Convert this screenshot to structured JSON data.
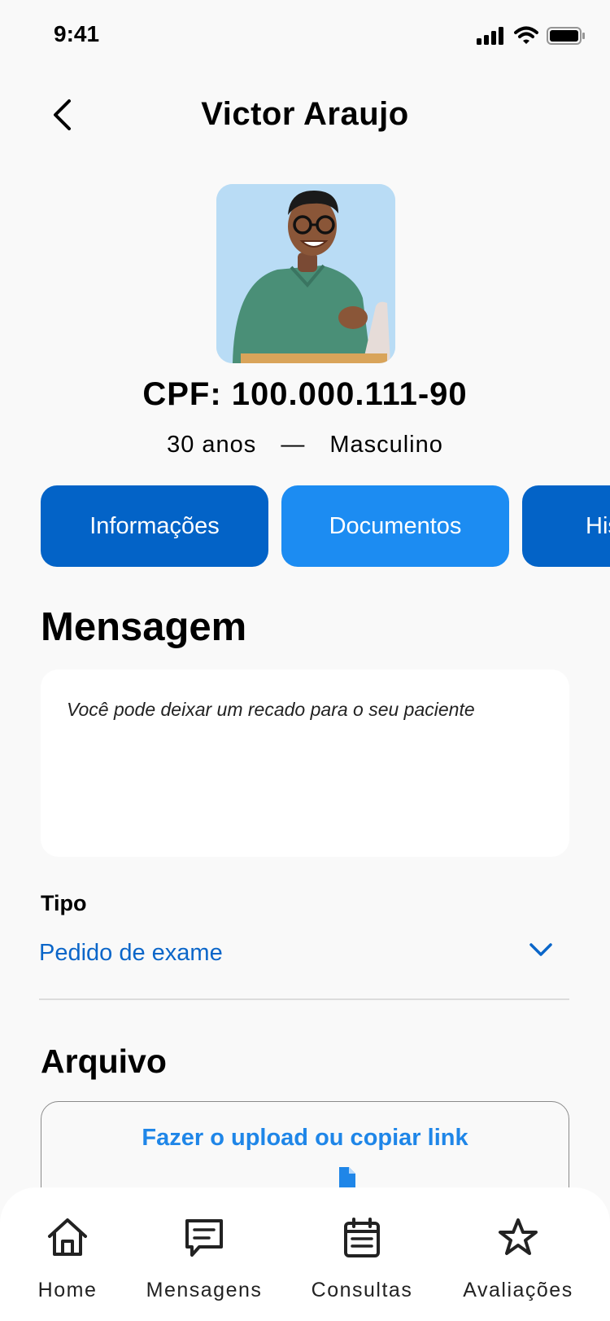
{
  "status_bar": {
    "time": "9:41",
    "icons": [
      "signal-icon",
      "wifi-icon",
      "battery-icon"
    ]
  },
  "header": {
    "back_icon": "chevron-left-icon",
    "title": "Victor Araujo"
  },
  "patient": {
    "cpf": "CPF: 100.000.111-90",
    "age": "30 anos",
    "separator": "—",
    "gender": "Masculino"
  },
  "tabs": [
    {
      "label": "Informações",
      "color": "#0363c7"
    },
    {
      "label": "Documentos",
      "color": "#1c8cf2",
      "selected": true
    },
    {
      "label": "Histórico",
      "color": "#0363c7"
    }
  ],
  "message": {
    "title": "Mensagem",
    "placeholder": "Você pode deixar um recado para o seu paciente"
  },
  "tipo": {
    "label": "Tipo",
    "value": "Pedido de exame",
    "icon": "chevron-down-icon"
  },
  "arquivo": {
    "title": "Arquivo",
    "upload_label": "Fazer o upload ou copiar link",
    "icon": "file-icon"
  },
  "bottom_nav": [
    {
      "label": "Home",
      "icon": "home-icon"
    },
    {
      "label": "Mensagens",
      "icon": "message-icon"
    },
    {
      "label": "Consultas",
      "icon": "calendar-icon"
    },
    {
      "label": "Avaliações",
      "icon": "star-icon"
    }
  ],
  "colors": {
    "primary_dark": "#0363c7",
    "primary_light": "#1c8cf2",
    "link": "#0b66c9",
    "upload_text": "#1f86e8",
    "background": "#f9f9f9"
  }
}
